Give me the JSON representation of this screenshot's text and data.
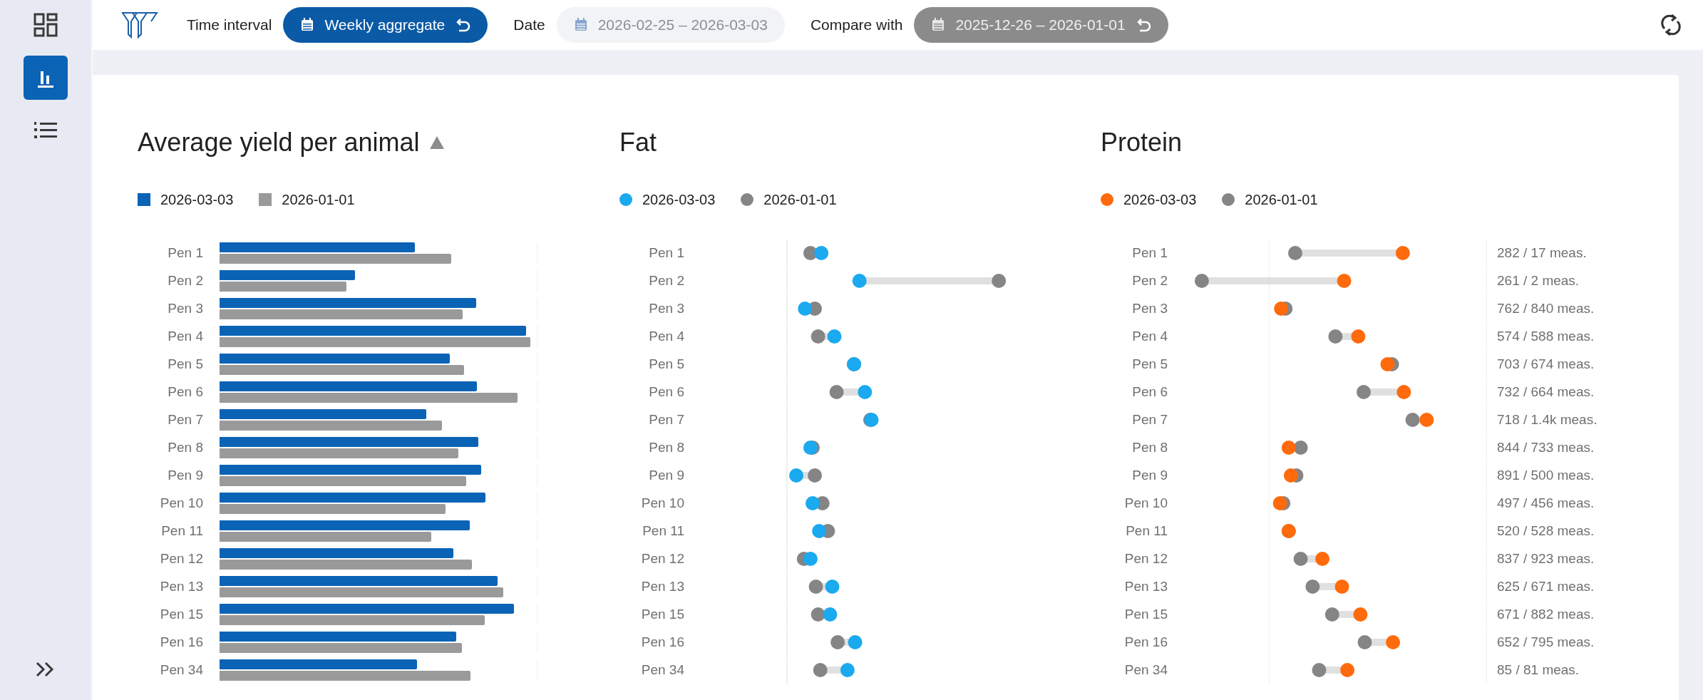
{
  "sidebar": {
    "items": [
      {
        "kind": "dashboard",
        "selected": false
      },
      {
        "kind": "chart",
        "selected": true
      },
      {
        "kind": "list",
        "selected": false
      }
    ]
  },
  "toolbar": {
    "filters": [
      {
        "label": "Time interval",
        "value": "Weekly aggregate",
        "kind": "primary",
        "resettable": true
      },
      {
        "label": "Date",
        "value": "2026-02-25 – 2026-03-03",
        "kind": "plain",
        "resettable": false
      },
      {
        "label": "Compare with",
        "value": "2025-12-26 – 2026-01-01",
        "kind": "muted",
        "resettable": true
      }
    ]
  },
  "charts": [
    {
      "kind": "bars",
      "title": "Average yield per animal",
      "sorted": true,
      "legend": [
        {
          "label": "2026-03-03",
          "color": "#0b63b6"
        },
        {
          "label": "2026-01-01",
          "color": "#9a9a9a"
        }
      ],
      "rows": [
        {
          "label": "Pen 1"
        },
        {
          "label": "Pen 2"
        },
        {
          "label": "Pen 3"
        },
        {
          "label": "Pen 4"
        },
        {
          "label": "Pen 5"
        },
        {
          "label": "Pen 6"
        },
        {
          "label": "Pen 7"
        },
        {
          "label": "Pen 8"
        },
        {
          "label": "Pen 9"
        },
        {
          "label": "Pen 10"
        },
        {
          "label": "Pen 11"
        },
        {
          "label": "Pen 12"
        },
        {
          "label": "Pen 13"
        },
        {
          "label": "Pen 15"
        },
        {
          "label": "Pen 16"
        },
        {
          "label": "Pen 34"
        }
      ]
    },
    {
      "kind": "dots",
      "title": "Fat",
      "sorted": false,
      "legend": [
        {
          "label": "2026-03-03",
          "color": "#1ba9f0"
        },
        {
          "label": "2026-01-01",
          "color": "#858585"
        }
      ],
      "rows": [
        {
          "label": "Pen 1"
        },
        {
          "label": "Pen 2"
        },
        {
          "label": "Pen 3"
        },
        {
          "label": "Pen 4"
        },
        {
          "label": "Pen 5"
        },
        {
          "label": "Pen 6"
        },
        {
          "label": "Pen 7"
        },
        {
          "label": "Pen 8"
        },
        {
          "label": "Pen 9"
        },
        {
          "label": "Pen 10"
        },
        {
          "label": "Pen 11"
        },
        {
          "label": "Pen 12"
        },
        {
          "label": "Pen 13"
        },
        {
          "label": "Pen 15"
        },
        {
          "label": "Pen 16"
        },
        {
          "label": "Pen 34"
        }
      ]
    },
    {
      "kind": "dots",
      "title": "Protein",
      "sorted": false,
      "legend": [
        {
          "label": "2026-03-03",
          "color": "#ff6a0c"
        },
        {
          "label": "2026-01-01",
          "color": "#858585"
        }
      ],
      "rows": [
        {
          "label": "Pen 1",
          "reading": "282 / 17 meas."
        },
        {
          "label": "Pen 2",
          "reading": "261 / 2 meas."
        },
        {
          "label": "Pen 3",
          "reading": "762 / 840 meas."
        },
        {
          "label": "Pen 4",
          "reading": "574 / 588 meas."
        },
        {
          "label": "Pen 5",
          "reading": "703 / 674 meas."
        },
        {
          "label": "Pen 6",
          "reading": "732 / 664 meas."
        },
        {
          "label": "Pen 7",
          "reading": "718 / 1.4k meas."
        },
        {
          "label": "Pen 8",
          "reading": "844 / 733 meas."
        },
        {
          "label": "Pen 9",
          "reading": "891 / 500 meas."
        },
        {
          "label": "Pen 10",
          "reading": "497 / 456 meas."
        },
        {
          "label": "Pen 11",
          "reading": "520 / 528 meas."
        },
        {
          "label": "Pen 12",
          "reading": "837 / 923 meas."
        },
        {
          "label": "Pen 13",
          "reading": "625 / 671 meas."
        },
        {
          "label": "Pen 15",
          "reading": "671 / 882 meas."
        },
        {
          "label": "Pen 16",
          "reading": "652 / 795 meas."
        },
        {
          "label": "Pen 34",
          "reading": "85 / 81 meas."
        }
      ]
    }
  ]
}
